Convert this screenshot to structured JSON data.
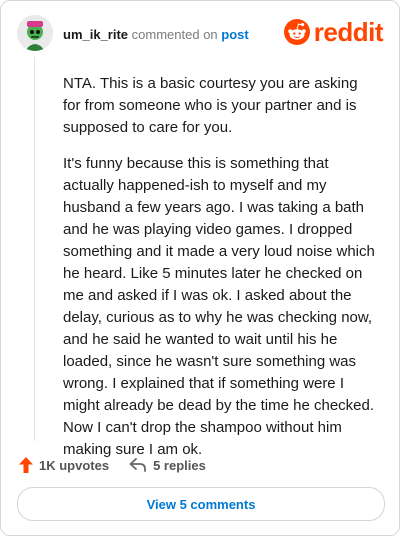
{
  "header": {
    "username": "um_ik_rite",
    "commented_text": "commented on",
    "post_link": "post",
    "brand": "reddit"
  },
  "comment": {
    "paragraphs": [
      "NTA. This is a basic courtesy you are asking for from someone who is your partner and is supposed to care for you.",
      "It's funny because this is something that actually happened-ish to myself and my husband a few years ago. I was taking a bath and he was playing video games. I dropped something and it made a very loud noise which he heard. Like 5 minutes later he checked on me and asked if I was ok. I asked about the delay, curious as to why he was checking now, and he said he wanted to wait until his he loaded, since he wasn't sure something was wrong. I explained that if something were I might already be dead by the time he checked. Now I can't drop the shampoo without him making sure I am ok."
    ]
  },
  "actions": {
    "upvotes": "1K upvotes",
    "replies": "5 replies"
  },
  "footer": {
    "view_comments": "View 5 comments"
  },
  "colors": {
    "brand": "#ff4500",
    "link": "#0079d3",
    "muted": "#7c7c7c"
  },
  "icons": {
    "avatar": "snoo-avatar",
    "logo": "reddit-alien-icon",
    "upvote": "upvote-arrow-icon",
    "reply": "reply-arrow-icon"
  }
}
